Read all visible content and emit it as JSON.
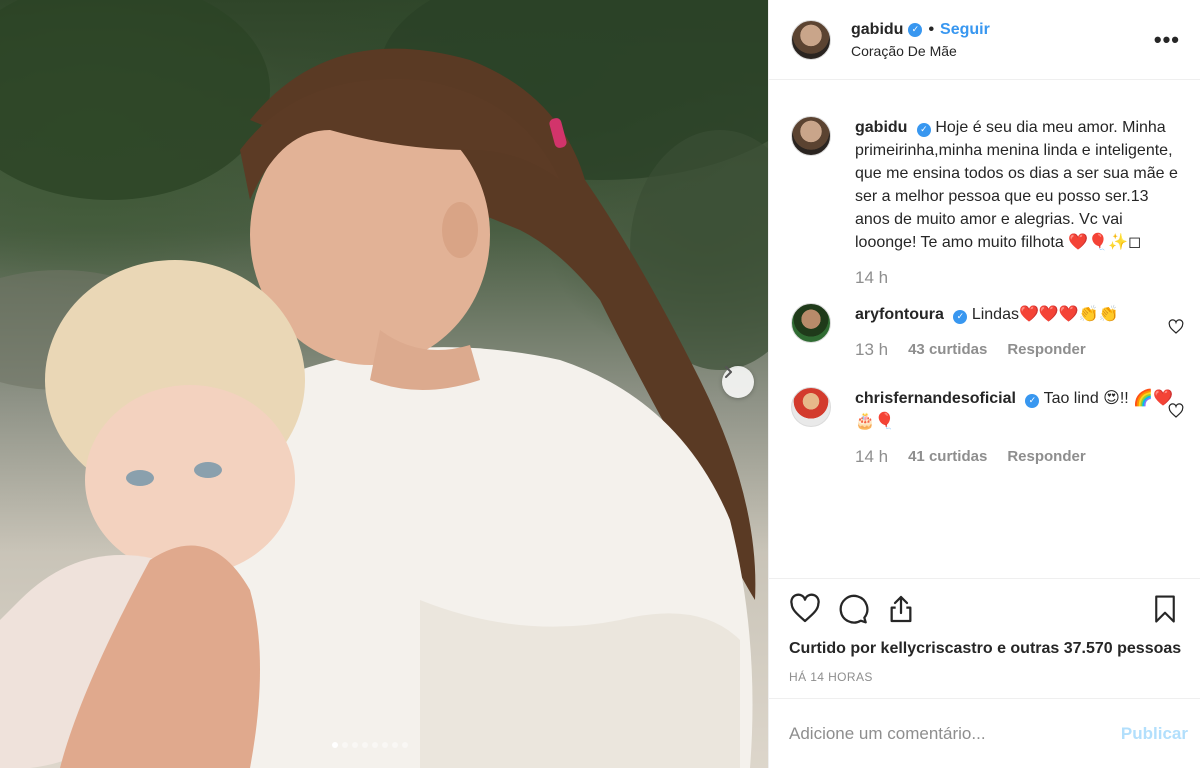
{
  "post": {
    "username": "gabidu",
    "follow_label": "Seguir",
    "bullet": "•",
    "location": "Coração De Mãe",
    "more": "•••"
  },
  "caption": {
    "username": "gabidu",
    "text": "Hoje é seu dia meu amor. Minha primeirinha,minha menina linda e inteligente, que me ensina todos os dias a ser sua mãe e ser a melhor pessoa que eu posso ser.13 anos de muito amor e alegrias. Vc vai looonge! Te amo muito filhota ❤️🎈✨◻",
    "time": "14 h"
  },
  "comments": [
    {
      "username": "aryfontoura",
      "text": "Lindas❤️❤️❤️👏👏",
      "time": "13 h",
      "likes": "43 curtidas",
      "reply": "Responder"
    },
    {
      "username": "chrisfernandesoficial",
      "text": "Tao lind 😍!! 🌈❤️🎂🎈",
      "time": "14 h",
      "likes": "41 curtidas",
      "reply": "Responder"
    }
  ],
  "likes_text": "Curtido por kellycriscastro e outras 37.570 pessoas",
  "posted_ago": "HÁ 14 HORAS",
  "comment_input": {
    "placeholder": "Adicione um comentário...",
    "publish_label": "Publicar"
  },
  "carousel": {
    "count": 8,
    "active": 0
  },
  "icons": [
    "heart-icon",
    "comment-icon",
    "share-icon",
    "bookmark-icon",
    "chevron-right-icon",
    "verified-badge-icon"
  ],
  "colors": {
    "accent": "#3897f0",
    "publish_disabled": "#b2dffc",
    "muted": "#8e8e8e",
    "text": "#262626"
  }
}
